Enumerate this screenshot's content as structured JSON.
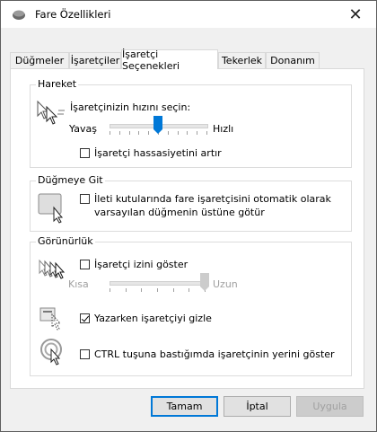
{
  "window": {
    "title": "Fare Özellikleri",
    "close_label": "✕"
  },
  "tabs": [
    {
      "label": "Düğmeler"
    },
    {
      "label": "İşaretçiler"
    },
    {
      "label": "İşaretçi Seçenekleri"
    },
    {
      "label": "Tekerlek"
    },
    {
      "label": "Donanım"
    }
  ],
  "motion": {
    "group_label": "Hareket",
    "speed_label": "İşaretçinizin hızını seçin:",
    "slow_label": "Yavaş",
    "fast_label": "Hızlı",
    "speed_value_fraction": 0.5,
    "precision_label": "İşaretçi hassasiyetini artır",
    "precision_checked": false
  },
  "snap_to": {
    "group_label": "Düğmeye Git",
    "line1": "İleti kutularında fare işaretçisini otomatik olarak",
    "line2": "varsayılan düğmenin üstüne götür",
    "checked": false
  },
  "visibility": {
    "group_label": "Görünürlük",
    "trails_label": "İşaretçi izini göster",
    "trails_checked": false,
    "short_label": "Kısa",
    "long_label": "Uzun",
    "trails_value_fraction": 1.0,
    "hide_typing_label": "Yazarken işaretçiyi gizle",
    "hide_typing_checked": true,
    "ctrl_label": "CTRL tuşuna bastığımda işaretçinin yerini göster",
    "ctrl_checked": false
  },
  "buttons": {
    "ok": "Tamam",
    "cancel": "İptal",
    "apply": "Uygula"
  },
  "colors": {
    "accent": "#0078d7",
    "disabled_text": "#a0a0a0"
  }
}
